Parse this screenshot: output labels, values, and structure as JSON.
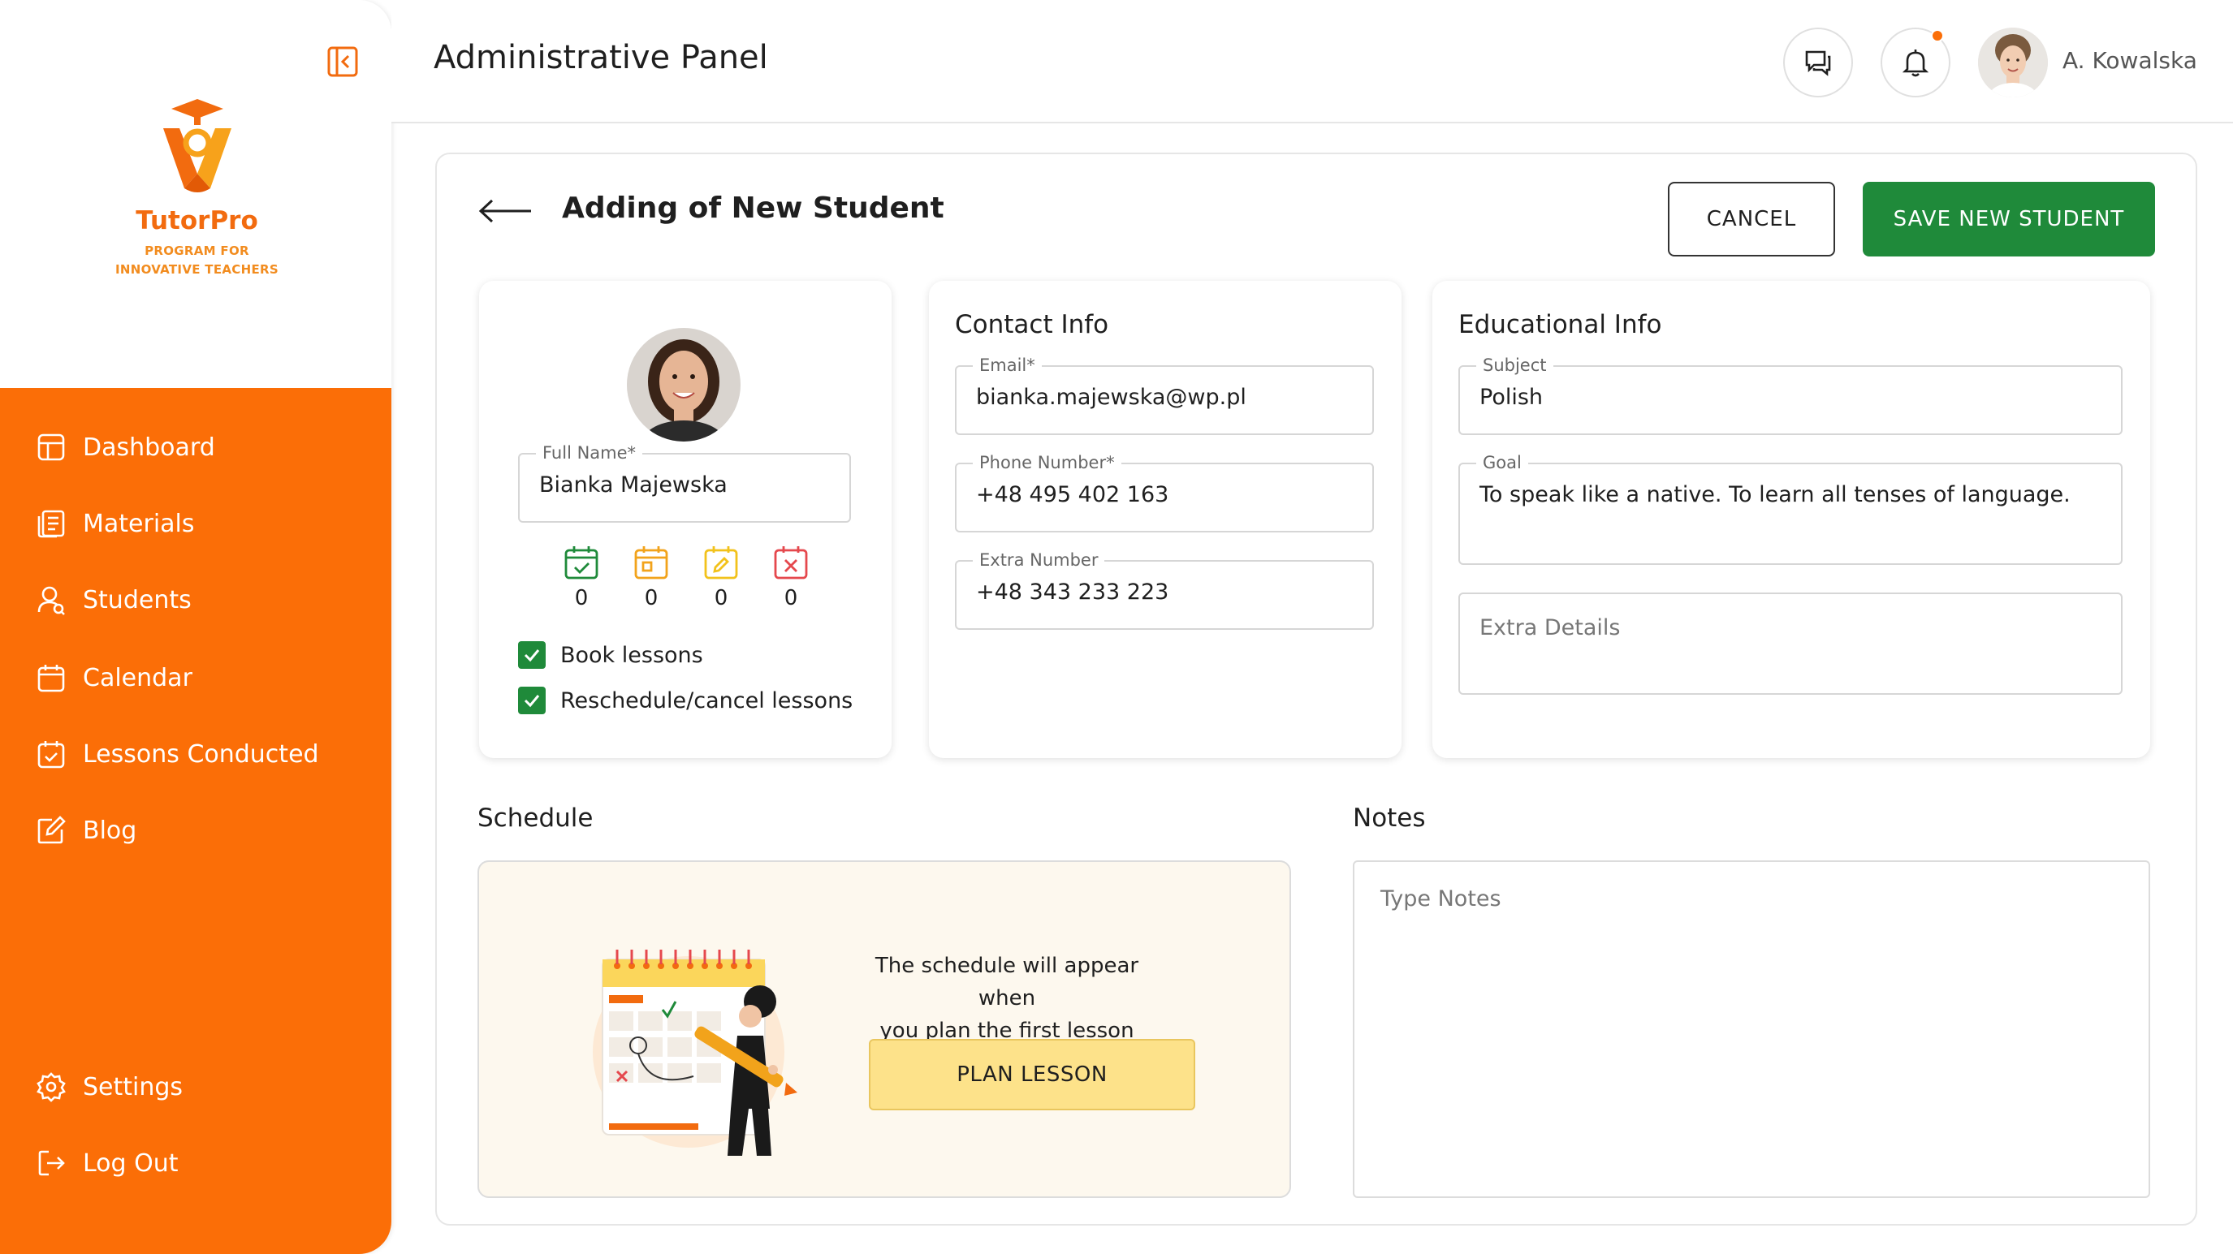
{
  "app": {
    "brand_name": "TutorPro",
    "brand_tagline_line1": "PROGRAM FOR",
    "brand_tagline_line2": "INNOVATIVE TEACHERS",
    "accent_color": "#fb6e07",
    "primary_button_color": "#1f8a3a"
  },
  "sidebar": {
    "items": [
      {
        "label": "Dashboard",
        "icon": "dashboard-icon"
      },
      {
        "label": "Materials",
        "icon": "materials-icon"
      },
      {
        "label": "Students",
        "icon": "students-icon"
      },
      {
        "label": "Calendar",
        "icon": "calendar-icon"
      },
      {
        "label": "Lessons Conducted",
        "icon": "calendar-check-icon"
      },
      {
        "label": "Blog",
        "icon": "edit-icon"
      }
    ],
    "bottom": [
      {
        "label": "Settings",
        "icon": "gear-icon"
      },
      {
        "label": "Log Out",
        "icon": "logout-icon"
      }
    ]
  },
  "header": {
    "title": "Administrative Panel",
    "user_name": "A. Kowalska"
  },
  "form": {
    "title": "Adding of New Student",
    "cancel_label": "CANCEL",
    "save_label": "SAVE NEW STUDENT"
  },
  "profile": {
    "full_name_label": "Full Name*",
    "full_name_value": "Bianka Majewska",
    "stats": [
      {
        "icon": "calendar-check-icon",
        "value": "0",
        "color": "#1f8a3a"
      },
      {
        "icon": "calendar-square-icon",
        "value": "0",
        "color": "#f2a31b"
      },
      {
        "icon": "calendar-edit-icon",
        "value": "0",
        "color": "#f2c21b"
      },
      {
        "icon": "calendar-cancel-icon",
        "value": "0",
        "color": "#e5484d"
      }
    ],
    "permissions": [
      {
        "label": "Book lessons",
        "checked": true
      },
      {
        "label": "Reschedule/cancel lessons",
        "checked": true
      }
    ]
  },
  "contact": {
    "title": "Contact Info",
    "email_label": "Email*",
    "email_value": "bianka.majewska@wp.pl",
    "phone_label": "Phone Number*",
    "phone_value": "+48 495 402 163",
    "extra_label": "Extra Number",
    "extra_value": "+48 343 233 223"
  },
  "education": {
    "title": "Educational Info",
    "subject_label": "Subject",
    "subject_value": "Polish",
    "goal_label": "Goal",
    "goal_value": "To speak like a native. To learn all tenses of language.",
    "extra_details_placeholder": "Extra Details"
  },
  "schedule": {
    "title": "Schedule",
    "message_line1": "The schedule will appear when",
    "message_line2": "you plan the first lesson",
    "plan_label": "PLAN LESSON"
  },
  "notes": {
    "title": "Notes",
    "placeholder": "Type Notes"
  }
}
